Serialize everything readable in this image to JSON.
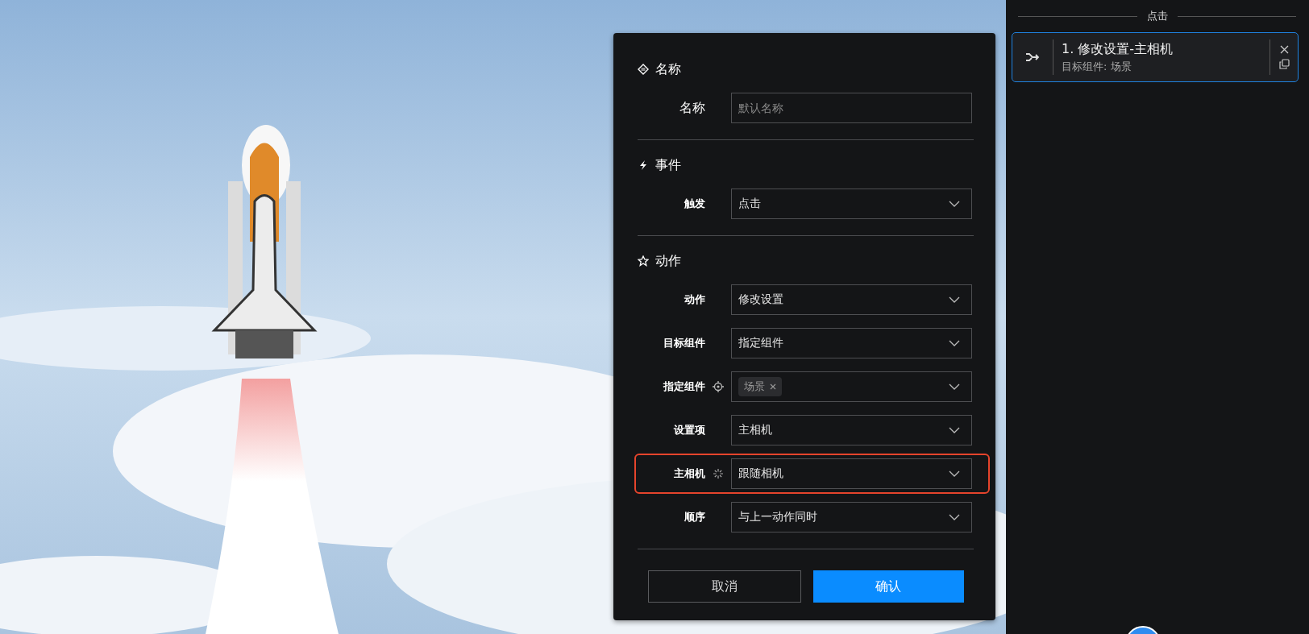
{
  "dialog": {
    "sections": [
      {
        "title": "名称",
        "fields": [
          {
            "label": "名称",
            "kind": "text",
            "placeholder": "默认名称"
          }
        ]
      },
      {
        "title": "事件",
        "fields": [
          {
            "label": "触发",
            "kind": "select",
            "value": "点击"
          }
        ]
      },
      {
        "title": "动作",
        "fields": [
          {
            "label": "动作",
            "kind": "select",
            "value": "修改设置"
          },
          {
            "label": "目标组件",
            "kind": "select",
            "value": "指定组件"
          },
          {
            "label": "指定组件",
            "kind": "tags",
            "tags": [
              "场景"
            ]
          },
          {
            "label": "设置项",
            "kind": "select",
            "value": "主相机"
          },
          {
            "label": "主相机",
            "kind": "effect_select",
            "value": "跟随相机",
            "highlighted": true
          },
          {
            "label": "顺序",
            "kind": "select",
            "value": "与上一动作同时"
          }
        ]
      }
    ],
    "buttons": [
      {
        "label": "取消",
        "kind": "secondary"
      },
      {
        "label": "确认",
        "kind": "primary"
      }
    ]
  },
  "panel": {
    "group_title": "点击",
    "actions": [
      {
        "title": "1. 修改设置-主相机",
        "subtitle": "目标组件: 场景",
        "selected": true
      }
    ]
  }
}
